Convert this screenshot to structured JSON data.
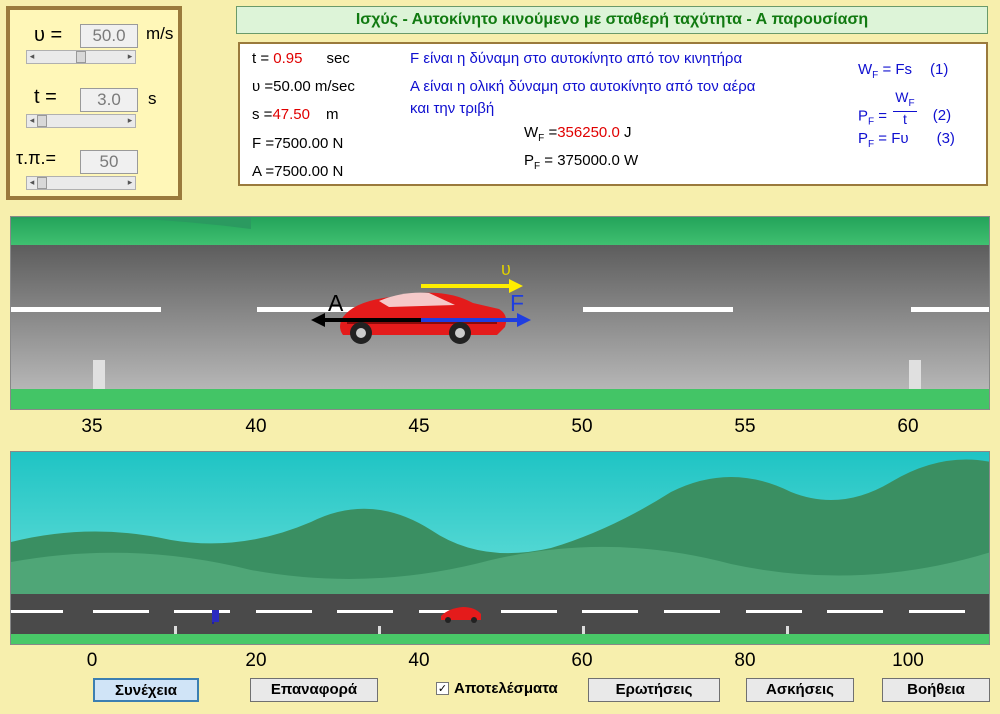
{
  "controls": {
    "velocity": {
      "label": "υ =",
      "value": "50.0",
      "unit": "m/s",
      "slider_fraction": 0.5
    },
    "time": {
      "label": "t =",
      "value": "3.0",
      "unit": "s",
      "slider_fraction": 0.0
    },
    "tp": {
      "label": "τ.π.=",
      "value": "50",
      "slider_fraction": 0.0
    }
  },
  "title": "Ισχύς - Αυτοκίνητο  κινούμενο με σταθερή ταχύτητα  - Α παρουσίαση",
  "info": {
    "t_label": "t = ",
    "t_value": "0.95",
    "t_unit": "sec",
    "u_text": "υ =50.00  m/sec",
    "s_label": "s =",
    "s_value": "47.50",
    "s_unit": "m",
    "F_text": "F =7500.00   N",
    "A_text": "A =7500.00   N",
    "desc_F": "F είναι η δύναμη στο αυτοκίνητο  από τον κινητήρα",
    "desc_A1": "Α είναι η ολική δύναμη στο αυτοκίνητο από τον αέρα",
    "desc_A2": "και την τριβή",
    "WF_label": "W",
    "WF_sub": "F",
    "WF_eq": " =",
    "WF_value": "356250.0",
    "WF_unit": " J",
    "PF_label": "P",
    "PF_sub": "F",
    "PF_text": " = 375000.0 W"
  },
  "formulas": {
    "f1_left": "W",
    "f1_sub": "F",
    "f1_right": " = Fs",
    "f1_num": "(1)",
    "f2_left": "P",
    "f2_sub": "F",
    "f2_eq": " =",
    "f2_frac_top": "W",
    "f2_frac_top_sub": "F",
    "f2_frac_bottom": "t",
    "f2_num": "(2)",
    "f3_left": "P",
    "f3_sub": "F",
    "f3_right": " = Fυ",
    "f3_num": "(3)"
  },
  "scene1": {
    "arrow_u_label": "υ",
    "arrow_F_label": "F",
    "arrow_A_label": "A",
    "ticks": [
      "35",
      "40",
      "45",
      "50",
      "55",
      "60"
    ]
  },
  "scene2": {
    "ticks": [
      "0",
      "20",
      "40",
      "60",
      "80",
      "100"
    ]
  },
  "buttons": {
    "continue": "Συνέχεια",
    "reset": "Επαναφορά",
    "results_label": "Αποτελέσματα",
    "results_checked": true,
    "questions": "Ερωτήσεις",
    "exercises": "Ασκήσεις",
    "help": "Βοήθεια"
  },
  "colors": {
    "accent_green": "#117a11",
    "force_blue": "#1f3ee0",
    "velocity_yellow": "#ffee00",
    "car_red": "#e41b1b"
  }
}
